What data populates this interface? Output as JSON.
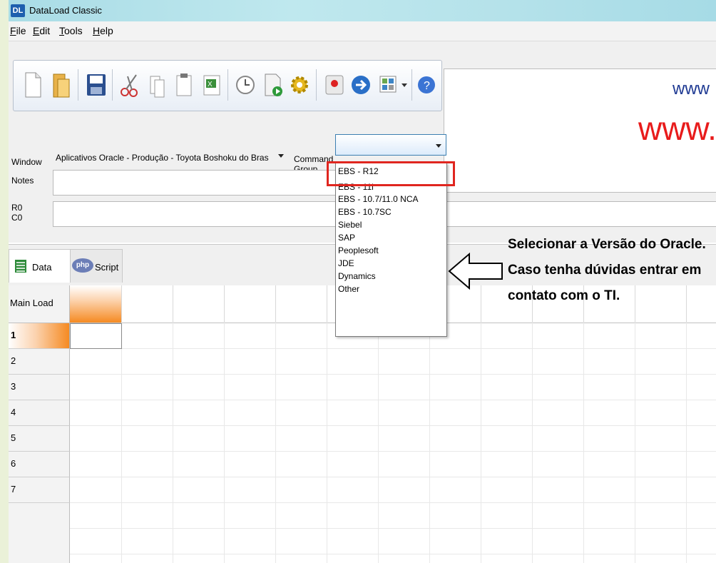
{
  "window": {
    "title": "DataLoad Classic",
    "app_icon": "DL"
  },
  "menu": [
    {
      "accel": "F",
      "rest": "ile"
    },
    {
      "accel": "E",
      "rest": "dit"
    },
    {
      "accel": "T",
      "rest": "ools"
    },
    {
      "accel": "H",
      "rest": "elp"
    }
  ],
  "toolbar_icons": [
    "new-file-icon",
    "open-file-icon",
    "save-icon",
    "cut-icon",
    "copy-icon",
    "paste-icon",
    "excel-icon",
    "clock-icon",
    "run-document-icon",
    "settings-gear-icon",
    "record-icon",
    "go-arrow-icon",
    "layout-grid-icon",
    "chevron-down-icon",
    "help-icon"
  ],
  "form": {
    "window_label": "Window",
    "window_value": "Aplicativos Oracle - Produção - Toyota Boshoku do Bras",
    "command_group_label_1": "Command",
    "command_group_label_2": "Group",
    "command_group_value": "",
    "notes_label": "Notes",
    "r0_label": "R0",
    "c0_label": "C0"
  },
  "banner": {
    "small_url": "www",
    "big_url": "www.d"
  },
  "tabs": [
    {
      "label": "Data",
      "icon": "data-sheet-icon"
    },
    {
      "label": "Script",
      "icon": "php-icon",
      "icon_text": "php"
    }
  ],
  "grid": {
    "corner_label": "Main Load",
    "rows": [
      "1",
      "2",
      "3",
      "4",
      "5",
      "6",
      "7"
    ]
  },
  "dropdown_options": [
    "EBS - R12",
    "EBS - 11i",
    "EBS - 10.7/11.0 NCA",
    "EBS - 10.7SC",
    "Siebel",
    "SAP",
    "Peoplesoft",
    "JDE",
    "Dynamics",
    "Other"
  ],
  "annotation": {
    "line1": "Selecionar a Versão do Oracle.",
    "line2": "Caso tenha dúvidas entrar em",
    "line3": "contato com o TI."
  },
  "colors": {
    "highlight": "#e0261f",
    "banner_red": "#e81b1b",
    "banner_blue": "#1f3a93",
    "accent_orange": "#f58a22"
  }
}
